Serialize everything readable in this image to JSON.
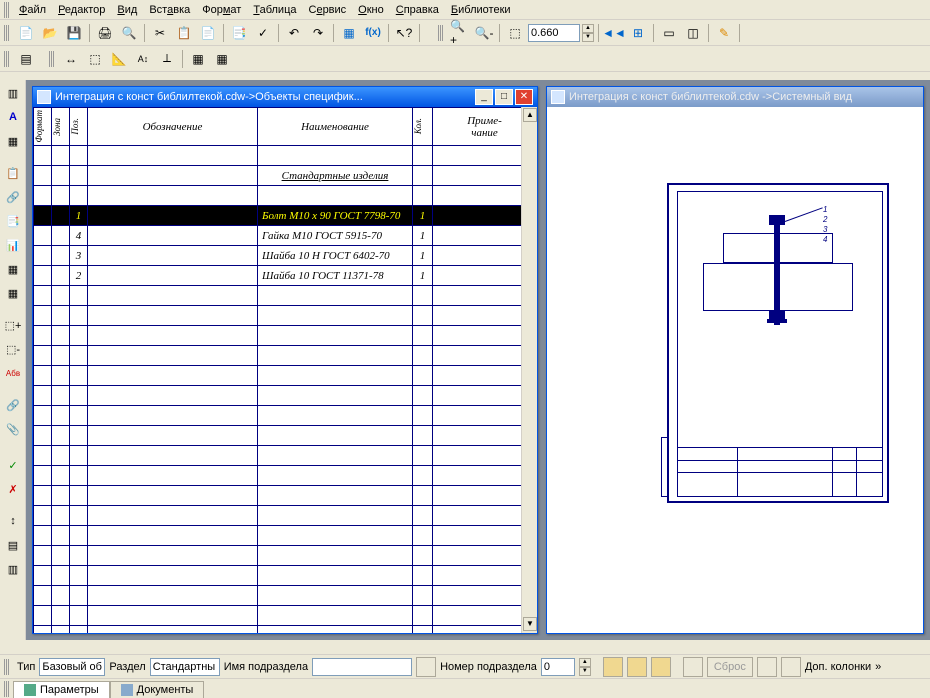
{
  "menu": {
    "file": "Файл",
    "editor": "Редактор",
    "view": "Вид",
    "insert": "Вставка",
    "format": "Формат",
    "table": "Таблица",
    "service": "Сервис",
    "window": "Окно",
    "help": "Справка",
    "libs": "Библиотеки"
  },
  "toolbar": {
    "zoom_value": "0.660",
    "fx_label": "f(x)"
  },
  "windows": {
    "spec_title": "Интеграция с конст библилтекой.cdw->Объекты специфик...",
    "draw_title": "Интеграция с конст библилтекой.cdw ->Системный вид"
  },
  "spec": {
    "headers": {
      "format": "Формат",
      "zona": "Зона",
      "poz": "Поз.",
      "obz": "Обозначение",
      "naim": "Наименование",
      "kol": "Кол.",
      "prim": "Приме-\nчание"
    },
    "section": "Стандартные изделия",
    "rows": [
      {
        "poz": "1",
        "naim": "Болт М10 x 90 ГОСТ 7798-70",
        "kol": "1",
        "selected": true
      },
      {
        "poz": "4",
        "naim": "Гайка М10 ГОСТ 5915-70",
        "kol": "1"
      },
      {
        "poz": "3",
        "naim": "Шайба 10 Н ГОСТ 6402-70",
        "kol": "1"
      },
      {
        "poz": "2",
        "naim": "Шайба 10 ГОСТ 11371-78",
        "kol": "1"
      }
    ]
  },
  "propbar": {
    "tip_label": "Тип",
    "tip_value": "Базовый об",
    "razdel_label": "Раздел",
    "razdel_value": "Стандартны",
    "imya_label": "Имя подраздела",
    "imya_value": "",
    "nomer_label": "Номер подраздела",
    "nomer_value": "0",
    "sbros": "Сброс",
    "dop": "Доп. колонки",
    "chev": "»"
  },
  "tabs": {
    "params": "Параметры",
    "docs": "Документы"
  }
}
